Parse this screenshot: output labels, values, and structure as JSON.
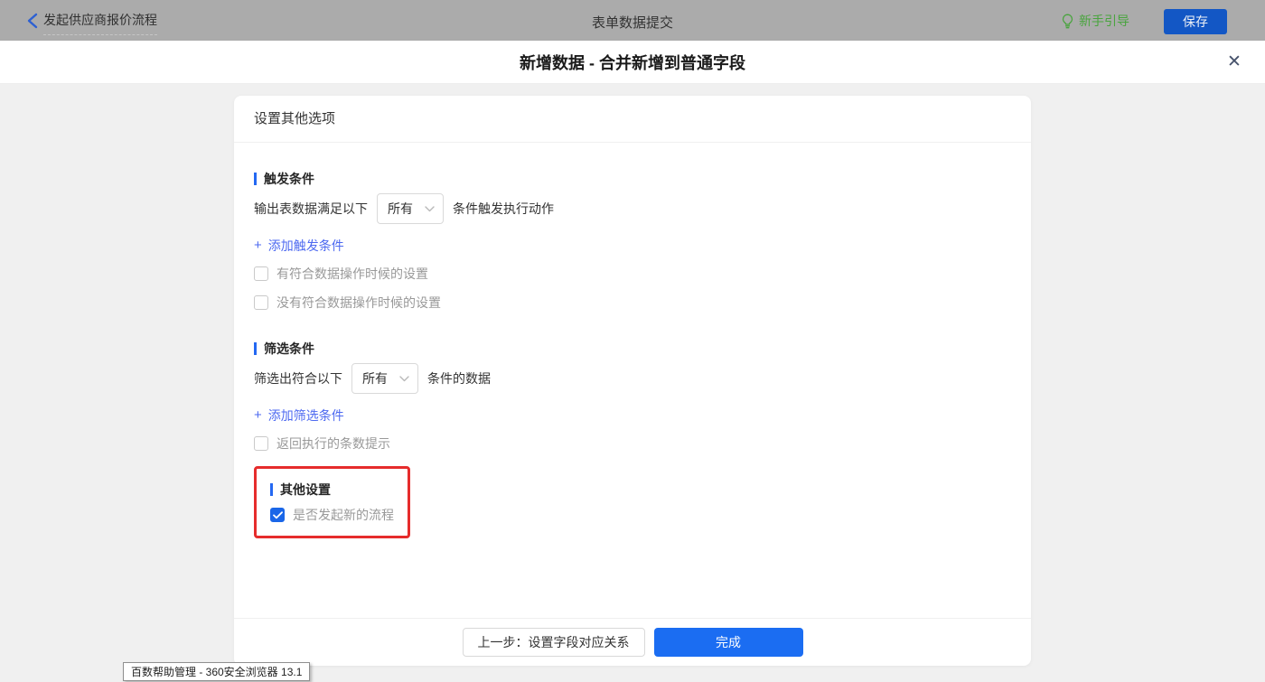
{
  "topbar": {
    "flow_title": "发起供应商报价流程",
    "center_title": "表单数据提交",
    "guide_label": "新手引导",
    "save_label": "保存"
  },
  "modal": {
    "title": "新增数据 - 合并新增到普通字段",
    "close_glyph": "✕"
  },
  "panel": {
    "header": "设置其他选项",
    "trigger_section": {
      "title": "触发条件",
      "row_prefix": "输出表数据满足以下",
      "select_value": "所有",
      "row_suffix": "条件触发执行动作",
      "add_plus": "+",
      "add_link_label": "添加触发条件",
      "checkboxes": [
        {
          "label": "有符合数据操作时候的设置",
          "checked": false
        },
        {
          "label": "没有符合数据操作时候的设置",
          "checked": false
        }
      ]
    },
    "filter_section": {
      "title": "筛选条件",
      "row_prefix": "筛选出符合以下",
      "select_value": "所有",
      "row_suffix": "条件的数据",
      "add_plus": "+",
      "add_link_label": "添加筛选条件",
      "checkboxes": [
        {
          "label": "返回执行的条数提示",
          "checked": false
        }
      ]
    },
    "other_section": {
      "title": "其他设置",
      "checkbox_label": "是否发起新的流程",
      "checked": true
    },
    "footer": {
      "prev_button": "上一步：设置字段对应关系",
      "done_button": "完成"
    }
  },
  "status_tooltip": "百数帮助管理 - 360安全浏览器 13.1",
  "colors": {
    "accent_blue": "#2468f2",
    "link_blue": "#4e6af0",
    "checked_blue": "#1a66e8",
    "highlight_red": "#e62c2c",
    "guide_green": "#49a43e",
    "topbar_dim_gray": "#ababab"
  }
}
